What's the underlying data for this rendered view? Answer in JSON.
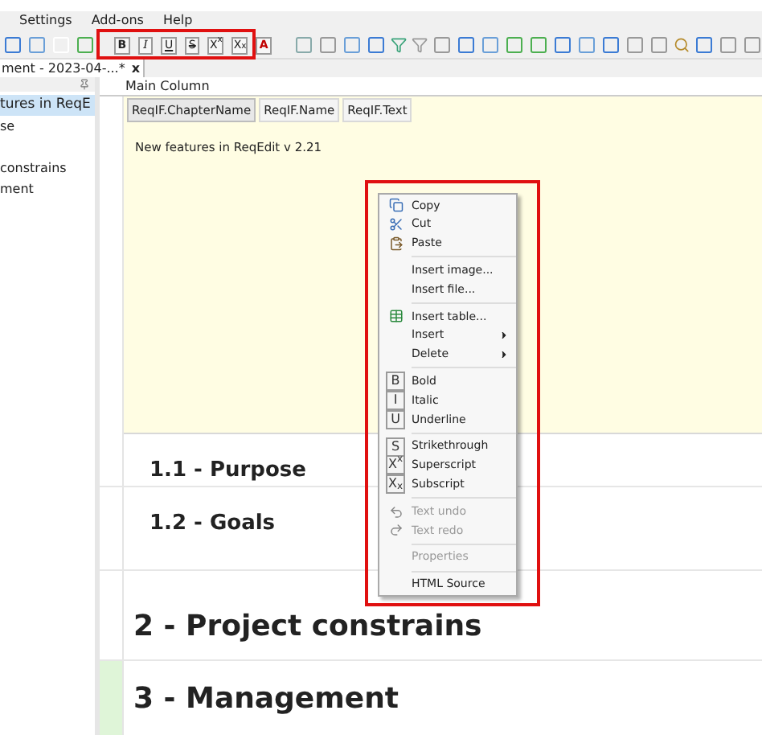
{
  "menu_bar": [
    "Settings",
    "Add-ons",
    "Help"
  ],
  "format_toolbar": [
    "B",
    "I",
    "U",
    "S",
    "X$^{x}$",
    "X$_{x}$",
    "A"
  ],
  "document_tab": {
    "title": "ment - 2023-04-...*",
    "close": "x"
  },
  "sidebar": {
    "items": [
      {
        "label": "tures in ReqE",
        "selected": true
      },
      {
        "label": "se",
        "selected": false
      },
      {
        "label": "constrains",
        "selected": false
      },
      {
        "label": "ment",
        "selected": false
      }
    ]
  },
  "main_column": {
    "title": "Main Column",
    "tabs": [
      {
        "label": "ReqIF.ChapterName",
        "selected": true
      },
      {
        "label": "ReqIF.Name",
        "selected": false
      },
      {
        "label": "ReqIF.Text",
        "selected": false
      }
    ],
    "editor_text": "New features in ReqEdit v 2.21"
  },
  "rows": [
    {
      "heading": "1.1 - Purpose",
      "kind": "subsection",
      "marked": false
    },
    {
      "heading": "1.2 - Goals",
      "kind": "subsection",
      "marked": false
    },
    {
      "heading": "2 - Project constrains",
      "kind": "section",
      "marked": false
    },
    {
      "heading": "3 - Management",
      "kind": "section",
      "marked": true
    }
  ],
  "context_menu": [
    {
      "kind": "item",
      "label": "Copy",
      "disabled": false
    },
    {
      "kind": "item",
      "label": "Cut",
      "disabled": false
    },
    {
      "kind": "item",
      "label": "Paste",
      "disabled": false
    },
    {
      "kind": "separator"
    },
    {
      "kind": "item",
      "label": "Insert image...",
      "disabled": false
    },
    {
      "kind": "item",
      "label": "Insert file...",
      "disabled": false
    },
    {
      "kind": "separator"
    },
    {
      "kind": "item",
      "label": "Insert table...",
      "disabled": false
    },
    {
      "kind": "submenu",
      "label": "Insert",
      "disabled": false
    },
    {
      "kind": "submenu",
      "label": "Delete",
      "disabled": false
    },
    {
      "kind": "separator"
    },
    {
      "kind": "item",
      "label": "Bold",
      "glyph": "B",
      "disabled": false
    },
    {
      "kind": "item",
      "label": "Italic",
      "glyph": "I",
      "disabled": false
    },
    {
      "kind": "item",
      "label": "Underline",
      "glyph": "U",
      "disabled": false
    },
    {
      "kind": "separator"
    },
    {
      "kind": "item",
      "label": "Strikethrough",
      "glyph": "S",
      "disabled": false
    },
    {
      "kind": "item",
      "label": "Superscript",
      "glyph": "X$^{x}$",
      "disabled": false
    },
    {
      "kind": "item",
      "label": "Subscript",
      "glyph": "X$_{x}$",
      "disabled": false
    },
    {
      "kind": "separator"
    },
    {
      "kind": "item",
      "label": "Text undo",
      "disabled": true
    },
    {
      "kind": "item",
      "label": "Text redo",
      "disabled": true
    },
    {
      "kind": "separator"
    },
    {
      "kind": "item",
      "label": "Properties",
      "disabled": true
    },
    {
      "kind": "separator"
    },
    {
      "kind": "item",
      "label": "HTML Source",
      "disabled": false
    }
  ]
}
